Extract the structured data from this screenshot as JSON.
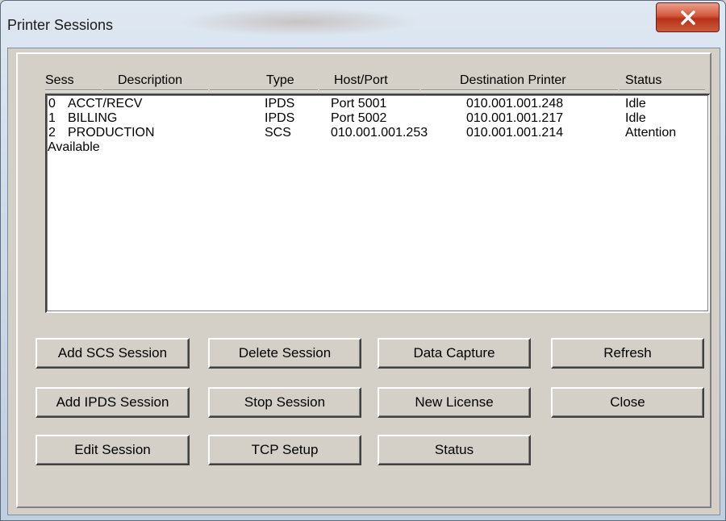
{
  "window": {
    "title": "Printer Sessions"
  },
  "columns": {
    "sess": "Sess",
    "description": "Description",
    "type": "Type",
    "host_port": "Host/Port",
    "destination_printer": "Destination Printer",
    "status": "Status"
  },
  "sessions": [
    {
      "sess": "0",
      "description": "ACCT/RECV",
      "type": "IPDS",
      "host_port": "Port 5001",
      "destination": "010.001.001.248",
      "status": "Idle"
    },
    {
      "sess": "1",
      "description": "BILLING",
      "type": "IPDS",
      "host_port": "Port 5002",
      "destination": "010.001.001.217",
      "status": "Idle"
    },
    {
      "sess": "2",
      "description": "PRODUCTION",
      "type": "SCS",
      "host_port": "010.001.001.253",
      "destination": "010.001.001.214",
      "status": "Attention"
    }
  ],
  "available_label": "Available",
  "buttons": {
    "add_scs": "Add SCS Session",
    "delete": "Delete Session",
    "data_capture": "Data Capture",
    "refresh": "Refresh",
    "add_ipds": "Add IPDS Session",
    "stop": "Stop Session",
    "new_license": "New License",
    "close": "Close",
    "edit": "Edit Session",
    "tcp_setup": "TCP Setup",
    "status": "Status"
  },
  "icons": {
    "close": "close-icon"
  },
  "colors": {
    "close_button": "#c8452a",
    "dialog_face": "#d4d0c8"
  }
}
